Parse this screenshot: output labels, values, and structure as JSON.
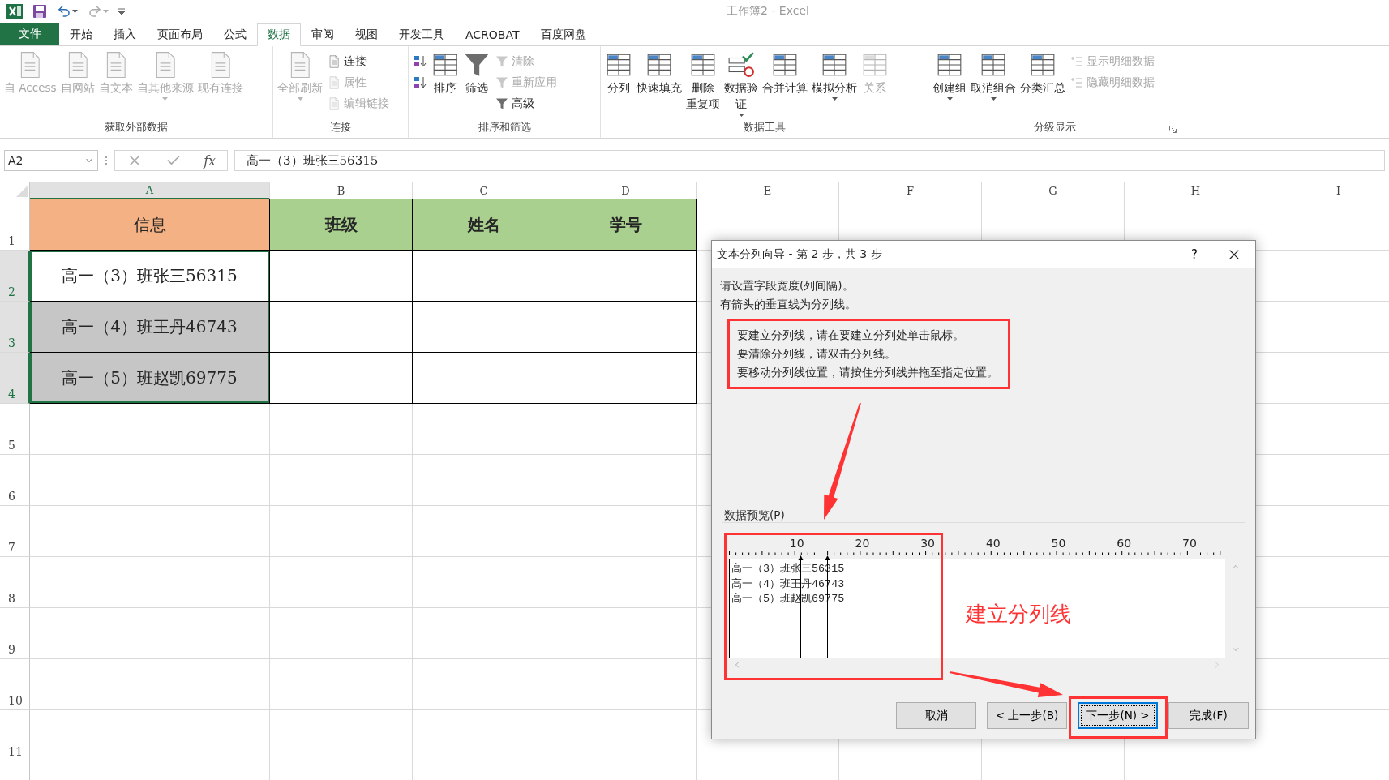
{
  "window": {
    "title": "工作簿2 - Excel"
  },
  "ribbon_tabs": [
    {
      "label": "文件",
      "kind": "file",
      "selected": false
    },
    {
      "label": "开始",
      "kind": "tab",
      "selected": false
    },
    {
      "label": "插入",
      "kind": "tab",
      "selected": false
    },
    {
      "label": "页面布局",
      "kind": "tab",
      "selected": false
    },
    {
      "label": "公式",
      "kind": "tab",
      "selected": false
    },
    {
      "label": "数据",
      "kind": "tab",
      "selected": true
    },
    {
      "label": "审阅",
      "kind": "tab",
      "selected": false
    },
    {
      "label": "视图",
      "kind": "tab",
      "selected": false
    },
    {
      "label": "开发工具",
      "kind": "tab",
      "selected": false
    },
    {
      "label": "ACROBAT",
      "kind": "tab",
      "selected": false
    },
    {
      "label": "百度网盘",
      "kind": "tab",
      "selected": false
    }
  ],
  "ribbon_groups": [
    {
      "label": "获取外部数据",
      "commands": [
        {
          "lines": [
            "自 Access"
          ],
          "kind": "large",
          "disabled": true,
          "dropdown": false
        },
        {
          "lines": [
            "自网站"
          ],
          "kind": "large",
          "disabled": true,
          "dropdown": false
        },
        {
          "lines": [
            "自文本"
          ],
          "kind": "large",
          "disabled": true,
          "dropdown": false
        },
        {
          "lines": [
            "自其他来源"
          ],
          "kind": "large",
          "disabled": true,
          "dropdown": true
        },
        {
          "lines": [
            "现有连接"
          ],
          "kind": "large",
          "disabled": true,
          "dropdown": false
        }
      ]
    },
    {
      "label": "连接",
      "commands": [
        {
          "lines": [
            "全部刷新"
          ],
          "kind": "large",
          "disabled": true,
          "dropdown": true
        },
        {
          "lines": [
            "连接"
          ],
          "kind": "small",
          "disabled": false,
          "dropdown": false
        },
        {
          "lines": [
            "属性"
          ],
          "kind": "small",
          "disabled": true,
          "dropdown": false
        },
        {
          "lines": [
            "编辑链接"
          ],
          "kind": "small",
          "disabled": true,
          "dropdown": false
        }
      ]
    },
    {
      "label": "排序和筛选",
      "commands": [
        {
          "kind": "small",
          "disabled": false,
          "dropdown": false
        },
        {
          "kind": "small",
          "disabled": false,
          "dropdown": false
        },
        {
          "lines": [
            "排序"
          ],
          "kind": "large",
          "disabled": false,
          "dropdown": false
        },
        {
          "lines": [
            "筛选"
          ],
          "kind": "large",
          "disabled": false,
          "dropdown": false
        },
        {
          "lines": [
            "清除"
          ],
          "kind": "small",
          "disabled": true,
          "dropdown": false
        },
        {
          "lines": [
            "重新应用"
          ],
          "kind": "small",
          "disabled": true,
          "dropdown": false
        },
        {
          "lines": [
            "高级"
          ],
          "kind": "small",
          "disabled": false,
          "dropdown": false
        }
      ]
    },
    {
      "label": "数据工具",
      "commands": [
        {
          "lines": [
            "分列"
          ],
          "kind": "large",
          "disabled": false,
          "dropdown": false
        },
        {
          "lines": [
            "快速填充"
          ],
          "kind": "large",
          "disabled": false,
          "dropdown": false
        },
        {
          "lines": [
            "删除",
            "重复项"
          ],
          "kind": "large",
          "disabled": false,
          "dropdown": false
        },
        {
          "lines": [
            "数据验",
            "证"
          ],
          "kind": "large",
          "disabled": false,
          "dropdown": true
        },
        {
          "lines": [
            "合并计算"
          ],
          "kind": "large",
          "disabled": false,
          "dropdown": false
        },
        {
          "lines": [
            "模拟分析"
          ],
          "kind": "large",
          "disabled": false,
          "dropdown": true
        },
        {
          "lines": [
            "关系"
          ],
          "kind": "large",
          "disabled": true,
          "dropdown": false
        }
      ]
    },
    {
      "label": "分级显示",
      "commands": [
        {
          "lines": [
            "创建组"
          ],
          "kind": "large",
          "disabled": false,
          "dropdown": true
        },
        {
          "lines": [
            "取消组合"
          ],
          "kind": "large",
          "disabled": false,
          "dropdown": true
        },
        {
          "lines": [
            "分类汇总"
          ],
          "kind": "large",
          "disabled": false,
          "dropdown": false
        },
        {
          "lines": [
            "显示明细数据"
          ],
          "kind": "small",
          "disabled": true,
          "dropdown": false
        },
        {
          "lines": [
            "隐藏明细数据"
          ],
          "kind": "small",
          "disabled": true,
          "dropdown": false
        }
      ]
    }
  ],
  "formula_bar": {
    "name_box": "A2",
    "function_label": "fx",
    "value": "高一（3）班张三56315"
  },
  "sheet": {
    "columns": [
      {
        "label": "A",
        "selected": true
      },
      {
        "label": "B",
        "selected": false
      },
      {
        "label": "C",
        "selected": false
      },
      {
        "label": "D",
        "selected": false
      },
      {
        "label": "E",
        "selected": false
      },
      {
        "label": "F",
        "selected": false
      },
      {
        "label": "G",
        "selected": false
      },
      {
        "label": "H",
        "selected": false
      },
      {
        "label": "I",
        "selected": false
      }
    ],
    "rows": [
      {
        "label": "1",
        "selected": false
      },
      {
        "label": "2",
        "selected": true
      },
      {
        "label": "3",
        "selected": true
      },
      {
        "label": "4",
        "selected": true
      },
      {
        "label": "5",
        "selected": false
      },
      {
        "label": "6",
        "selected": false
      },
      {
        "label": "7",
        "selected": false
      },
      {
        "label": "8",
        "selected": false
      },
      {
        "label": "9",
        "selected": false
      },
      {
        "label": "10",
        "selected": false
      },
      {
        "label": "11",
        "selected": false
      }
    ],
    "table": [
      [
        {
          "text": "信息",
          "color": "#f4b183",
          "strong": false,
          "selected": false
        },
        {
          "text": "班级",
          "color": "#a9d08e",
          "strong": true,
          "selected": false
        },
        {
          "text": "姓名",
          "color": "#a9d08e",
          "strong": true,
          "selected": false
        },
        {
          "text": "学号",
          "color": "#a9d08e",
          "strong": true,
          "selected": false
        }
      ],
      [
        {
          "text": "高一（3）班张三56315",
          "selected": true,
          "active": true
        },
        {
          "selected": false
        },
        {
          "selected": false
        },
        {
          "selected": false
        }
      ],
      [
        {
          "text": "高一（4）班王丹46743",
          "selected": true,
          "active": false
        },
        {
          "selected": false
        },
        {
          "selected": false
        },
        {
          "selected": false
        }
      ],
      [
        {
          "text": "高一（5）班赵凯69775",
          "selected": true,
          "active": false
        },
        {
          "selected": false
        },
        {
          "selected": false
        },
        {
          "selected": false
        }
      ]
    ]
  },
  "dialog": {
    "title": "文本分列向导 - 第 2 步，共 3 步",
    "help": "?",
    "intro": [
      "请设置字段宽度(列间隔)。",
      "有箭头的垂直线为分列线。"
    ],
    "hints": [
      "要建立分列线，请在要建立分列处单击鼠标。",
      "要清除分列线，请双击分列线。",
      "要移动分列线位置，请按住分列线并拖至指定位置。"
    ],
    "preview_label": "数据预览(P)",
    "ruler_labels": [
      "10",
      "20",
      "30",
      "40",
      "50",
      "60",
      "70"
    ],
    "preview_lines": [
      "高一（3）班张三56315",
      "高一（4）班王丹46743",
      "高一（5）班赵凯69775"
    ],
    "breaks": [
      {
        "level": 0.144
      },
      {
        "level": 0.198
      }
    ],
    "buttons": [
      {
        "label": "取消",
        "default": false
      },
      {
        "label": "< 上一步(B)",
        "default": false
      },
      {
        "label": "下一步(N) >",
        "default": true
      },
      {
        "label": "完成(F)",
        "default": false
      }
    ]
  },
  "annotation": {
    "callout": "建立分列线"
  }
}
